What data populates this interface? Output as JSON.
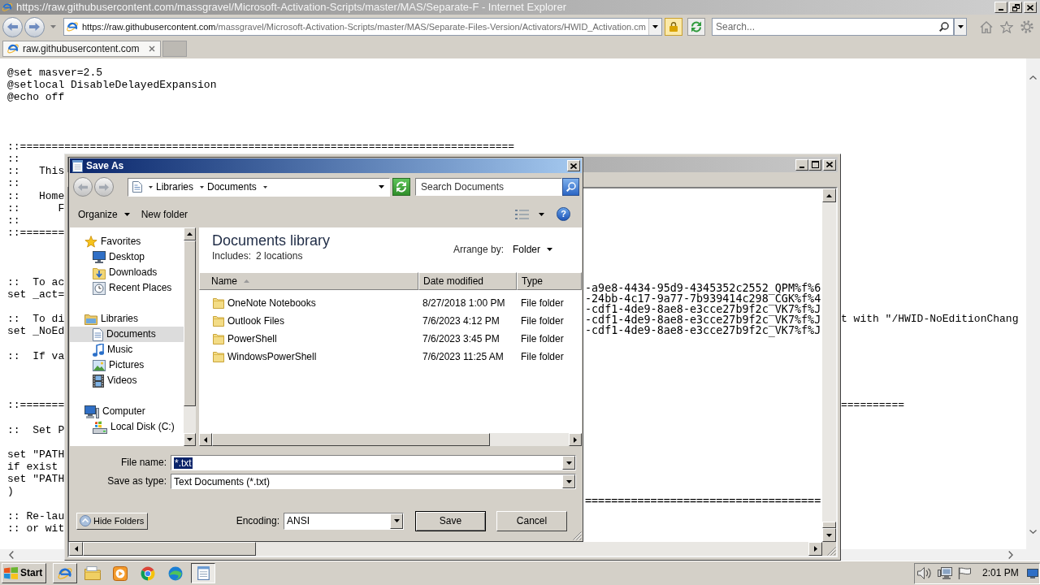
{
  "browser": {
    "title": "https://raw.githubusercontent.com/massgravel/Microsoft-Activation-Scripts/master/MAS/Separate-F - Internet Explorer",
    "address": {
      "host": "https://raw.githubusercontent.com",
      "path": "/massgravel/Microsoft-Activation-Scripts/master/MAS/Separate-Files-Version/Activators/HWID_Activation.cm"
    },
    "search": {
      "placeholder": "Search..."
    },
    "tabs": [
      {
        "label": "raw.githubusercontent.com",
        "selected": true
      }
    ],
    "lines": [
      {
        "kind": "code",
        "text": "@set masver=2.5"
      },
      {
        "kind": "code",
        "text": "@setlocal DisableDelayedExpansion"
      },
      {
        "kind": "code",
        "text": "@echo off"
      },
      {
        "kind": "blank"
      },
      {
        "kind": "blank"
      },
      {
        "kind": "blank"
      },
      {
        "kind": "code",
        "text": "::=============================================================================="
      },
      {
        "kind": "code",
        "text": "::"
      },
      {
        "kind": "code",
        "text": "::   This"
      },
      {
        "kind": "code",
        "text": "::"
      },
      {
        "kind": "code",
        "text": "::   Home"
      },
      {
        "kind": "code",
        "text": "::      F"
      },
      {
        "kind": "code",
        "text": "::"
      },
      {
        "kind": "code",
        "text": "::======="
      },
      {
        "kind": "blank"
      },
      {
        "kind": "blank"
      },
      {
        "kind": "blank"
      },
      {
        "kind": "code",
        "text": "::  To ac"
      },
      {
        "kind": "code",
        "text": "set _act="
      },
      {
        "kind": "blank"
      },
      {
        "kind": "code",
        "text": "::  To di",
        "tail": "t with \"/HWID-NoEditionChang"
      },
      {
        "kind": "code",
        "text": "set _NoEd"
      },
      {
        "kind": "blank"
      },
      {
        "kind": "code",
        "text": "::  If va"
      },
      {
        "kind": "blank"
      },
      {
        "kind": "blank"
      },
      {
        "kind": "blank"
      },
      {
        "kind": "code",
        "text": "::=======",
        "tail": "=========="
      },
      {
        "kind": "blank"
      },
      {
        "kind": "code",
        "text": "::  Set P"
      },
      {
        "kind": "blank"
      },
      {
        "kind": "code",
        "text": "set \"PATH"
      },
      {
        "kind": "code",
        "text": "if exist"
      },
      {
        "kind": "code",
        "text": "set \"PATH"
      },
      {
        "kind": "code",
        "text": ")"
      },
      {
        "kind": "blank"
      },
      {
        "kind": "code",
        "text": ":: Re-lau"
      },
      {
        "kind": "code",
        "text": ":: or wit"
      }
    ]
  },
  "notepad": {
    "lines": [
      {
        "kind": "text",
        "text": "-a9e8-4434-95d9-4345352c2552_QPM%f%6"
      },
      {
        "kind": "text",
        "text": "-24bb-4c17-9a77-7b939414c298_CGK%f%4"
      },
      {
        "kind": "text",
        "text": "-cdf1-4de9-8ae8-e3cce27b9f2c_VK7%f%J"
      },
      {
        "kind": "text",
        "text": "-cdf1-4de9-8ae8-e3cce27b9f2c_VK7%f%J"
      },
      {
        "kind": "text",
        "text": "-cdf1-4de9-8ae8-e3cce27b9f2c_VK7%f%J"
      },
      {
        "kind": "blank"
      },
      {
        "kind": "blank"
      },
      {
        "kind": "blank"
      },
      {
        "kind": "blank"
      },
      {
        "kind": "blank"
      },
      {
        "kind": "blank"
      },
      {
        "kind": "blank"
      },
      {
        "kind": "blank"
      },
      {
        "kind": "blank"
      },
      {
        "kind": "blank"
      },
      {
        "kind": "blank"
      },
      {
        "kind": "blank"
      },
      {
        "kind": "blank"
      },
      {
        "kind": "blank"
      },
      {
        "kind": "blank"
      },
      {
        "kind": "text",
        "text": "===================================="
      }
    ]
  },
  "save_dialog": {
    "title": "Save As",
    "breadcrumb": [
      "Libraries",
      "Documents"
    ],
    "search": {
      "placeholder": "Search Documents"
    },
    "toolbar": {
      "organize": "Organize",
      "new_folder": "New folder",
      "help": "?"
    },
    "navigation": [
      {
        "kind": "favorites",
        "label": "Favorites",
        "selected": false,
        "children": [
          {
            "kind": "desktop",
            "label": "Desktop",
            "selected": false
          },
          {
            "kind": "downloads",
            "label": "Downloads",
            "selected": false
          },
          {
            "kind": "recent",
            "label": "Recent Places",
            "selected": false
          }
        ]
      },
      {
        "kind": "libraries",
        "label": "Libraries",
        "selected": false,
        "children": [
          {
            "kind": "documents",
            "label": "Documents",
            "selected": true
          },
          {
            "kind": "music",
            "label": "Music",
            "selected": false
          },
          {
            "kind": "pictures",
            "label": "Pictures",
            "selected": false
          },
          {
            "kind": "videos",
            "label": "Videos",
            "selected": false
          }
        ]
      },
      {
        "kind": "computer",
        "label": "Computer",
        "selected": false,
        "children": [
          {
            "kind": "disk",
            "label": "Local Disk (C:)",
            "selected": false
          }
        ]
      }
    ],
    "library": {
      "title": "Documents library",
      "includes_label": "Includes:",
      "includes_link": "2 locations",
      "arrange_label": "Arrange by:",
      "arrange_value": "Folder"
    },
    "columns": [
      {
        "label": "Name",
        "sorted": true
      },
      {
        "label": "Date modified",
        "sorted": false
      },
      {
        "label": "Type",
        "sorted": false
      }
    ],
    "files": [
      {
        "name": "OneNote Notebooks",
        "date": "8/27/2018 1:00 PM",
        "type": "File folder"
      },
      {
        "name": "Outlook Files",
        "date": "7/6/2023 4:12 PM",
        "type": "File folder"
      },
      {
        "name": "PowerShell",
        "date": "7/6/2023 3:45 PM",
        "type": "File folder"
      },
      {
        "name": "WindowsPowerShell",
        "date": "7/6/2023 11:25 AM",
        "type": "File folder"
      }
    ],
    "file_name": {
      "label": "File name:",
      "value": "*.txt",
      "highlighted": true
    },
    "save_as_type": {
      "label": "Save as type:",
      "value": "Text Documents (*.txt)"
    },
    "hide_folders": "Hide Folders",
    "encoding": {
      "label": "Encoding:",
      "value": "ANSI"
    },
    "buttons": [
      {
        "label": "Save",
        "default": true
      },
      {
        "label": "Cancel",
        "default": false
      }
    ]
  },
  "taskbar": {
    "start": "Start",
    "items": [
      {
        "kind": "ie",
        "running": true,
        "selected": false
      },
      {
        "kind": "explorer",
        "running": false,
        "selected": false
      },
      {
        "kind": "player",
        "running": false,
        "selected": false
      },
      {
        "kind": "chrome",
        "running": false,
        "selected": false
      },
      {
        "kind": "edge",
        "running": false,
        "selected": false
      },
      {
        "kind": "notepad",
        "running": true,
        "selected": true
      }
    ],
    "clock": "2:01 PM"
  }
}
